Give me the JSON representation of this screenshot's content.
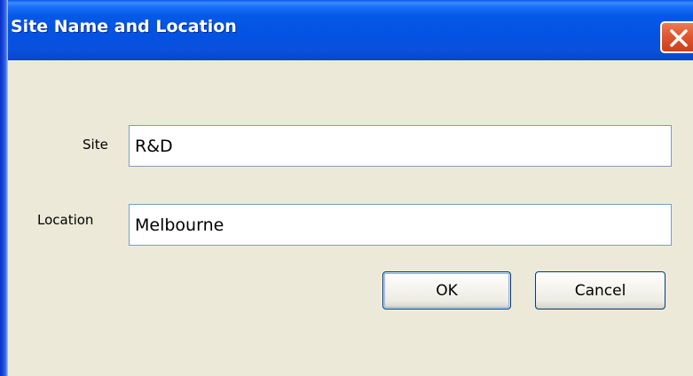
{
  "window": {
    "title": "Site Name and Location"
  },
  "form": {
    "site": {
      "label": "Site",
      "value": "R&D"
    },
    "location": {
      "label": "Location",
      "value": "Melbourne"
    }
  },
  "buttons": {
    "ok_label": "OK",
    "cancel_label": "Cancel"
  },
  "icons": {
    "close": "close-icon"
  },
  "colors": {
    "titlebar": "#0452e2",
    "dialog_background": "#ece9d8",
    "close_button": "#e0572f",
    "input_border": "#7f9db9",
    "button_border": "#003c74"
  }
}
